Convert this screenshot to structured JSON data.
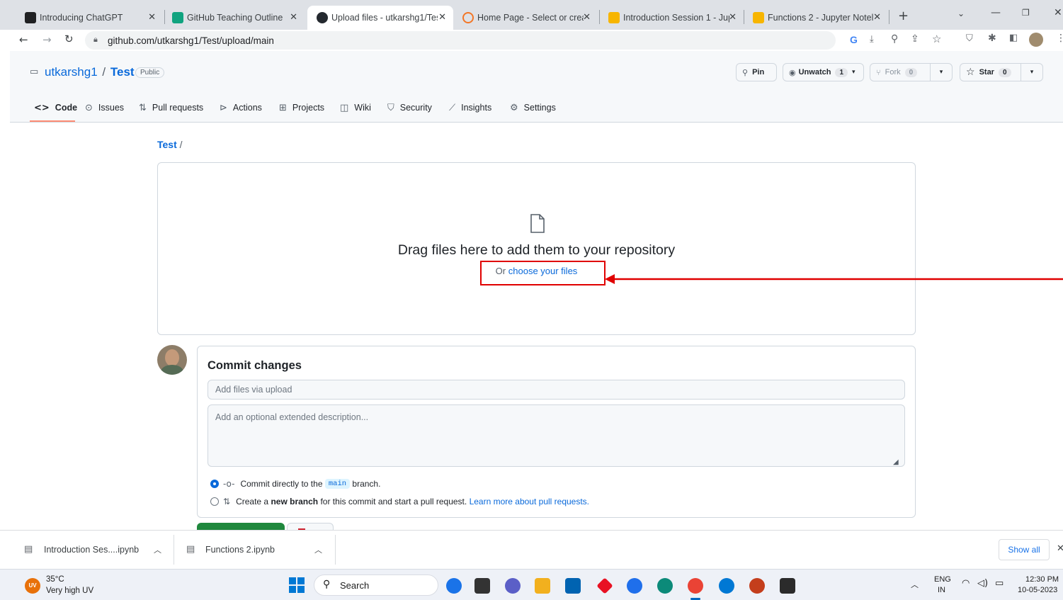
{
  "browser": {
    "tabs": [
      {
        "title": "Introducing ChatGPT",
        "color": "#202123"
      },
      {
        "title": "GitHub Teaching Outline",
        "color": "#10a37f"
      },
      {
        "title": "Upload files - utkarshg1/Tes",
        "color": "#24292f"
      },
      {
        "title": "Home Page - Select or crea",
        "color": "#f37626"
      },
      {
        "title": "Introduction Session 1 - Jup",
        "color": "#f7b500"
      },
      {
        "title": "Functions 2 - Jupyter Notel",
        "color": "#f7b500"
      }
    ],
    "url": "github.com/utkarshg1/Test/upload/main"
  },
  "repo": {
    "owner": "utkarshg1",
    "separator": "/",
    "name": "Test",
    "visibility": "Public",
    "pin_label": "Pin",
    "unwatch_label": "Unwatch",
    "unwatch_count": "1",
    "fork_label": "Fork",
    "fork_count": "0",
    "star_label": "Star",
    "star_count": "0"
  },
  "nav": [
    {
      "label": "Code"
    },
    {
      "label": "Issues"
    },
    {
      "label": "Pull requests"
    },
    {
      "label": "Actions"
    },
    {
      "label": "Projects"
    },
    {
      "label": "Wiki"
    },
    {
      "label": "Security"
    },
    {
      "label": "Insights"
    },
    {
      "label": "Settings"
    }
  ],
  "breadcrumb": {
    "repo": "Test",
    "sep": "/"
  },
  "dropzone": {
    "title": "Drag files here to add them to your repository",
    "prefix": "Or",
    "link": "choose your files"
  },
  "commit": {
    "title": "Commit changes",
    "summary_placeholder": "Add files via upload",
    "description_placeholder": "Add an optional extended description...",
    "option1_pre": "Commit directly to the",
    "option1_branch": "main",
    "option1_post": "branch.",
    "option2_pre": "Create a",
    "option2_bold": "new branch",
    "option2_post": "for this commit and start a pull request.",
    "option2_link": "Learn more about pull requests."
  },
  "downloads": {
    "items": [
      {
        "name": "Introduction Ses....ipynb"
      },
      {
        "name": "Functions 2.ipynb"
      }
    ],
    "show_all": "Show all"
  },
  "taskbar": {
    "weather_badge": "UV",
    "temp": "35°C",
    "condition": "Very high UV",
    "search": "Search",
    "lang1": "ENG",
    "lang2": "IN",
    "time": "12:30 PM",
    "date": "10-05-2023"
  },
  "colors": {
    "annotation": "#e00000",
    "accent": "#fd8c73",
    "link": "#0969da",
    "commit_button": "#1f883d"
  }
}
